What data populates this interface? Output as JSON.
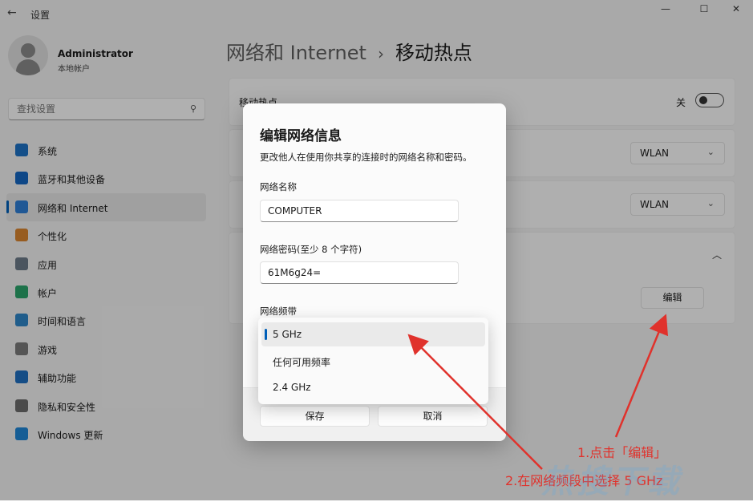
{
  "app": {
    "title": "设置"
  },
  "window_controls": {
    "minimize": "—",
    "maximize": "☐",
    "close": "✕"
  },
  "user": {
    "name": "Administrator",
    "account_type": "本地帐户"
  },
  "search": {
    "placeholder": "查找设置"
  },
  "sidebar": {
    "items": [
      {
        "label": "系统",
        "icon": "system-icon",
        "color": "#1d71c4"
      },
      {
        "label": "蓝牙和其他设备",
        "icon": "bluetooth-icon",
        "color": "#1566c2"
      },
      {
        "label": "网络和 Internet",
        "icon": "wifi-icon",
        "color": "#2f7fd6",
        "active": true
      },
      {
        "label": "个性化",
        "icon": "brush-icon",
        "color": "#d8852f"
      },
      {
        "label": "应用",
        "icon": "apps-icon",
        "color": "#6c7a89"
      },
      {
        "label": "帐户",
        "icon": "account-icon",
        "color": "#2aa46b"
      },
      {
        "label": "时间和语言",
        "icon": "globe-clock-icon",
        "color": "#2f86c8"
      },
      {
        "label": "游戏",
        "icon": "gamepad-icon",
        "color": "#7a7a7a"
      },
      {
        "label": "辅助功能",
        "icon": "accessibility-icon",
        "color": "#1f6fc1"
      },
      {
        "label": "隐私和安全性",
        "icon": "shield-icon",
        "color": "#6c6c6c"
      },
      {
        "label": "Windows 更新",
        "icon": "update-icon",
        "color": "#1f86d6"
      }
    ]
  },
  "breadcrumb": {
    "parent": "网络和 Internet",
    "separator": "›",
    "current": "移动热点"
  },
  "main": {
    "hotspot_label": "移动热点",
    "toggle_state": "关",
    "share_from_value": "WLAN",
    "share_over_value": "WLAN",
    "edit_label": "编辑"
  },
  "dialog": {
    "title": "编辑网络信息",
    "description": "更改他人在使用你共享的连接时的网络名称和密码。",
    "name_label": "网络名称",
    "name_value": "COMPUTER",
    "password_label": "网络密码(至少 8 个字符)",
    "password_value": "61M6g24=",
    "band_label": "网络频带",
    "band_options": [
      "5 GHz",
      "任何可用频率",
      "2.4 GHz"
    ],
    "band_selected": "5 GHz",
    "save_label": "保存",
    "cancel_label": "取消"
  },
  "annotations": {
    "step1": "1.点击「编辑」",
    "step2": "2.在网络频段中选择 5 GHz",
    "color": "#e0322c"
  },
  "watermark": "热搜下载"
}
